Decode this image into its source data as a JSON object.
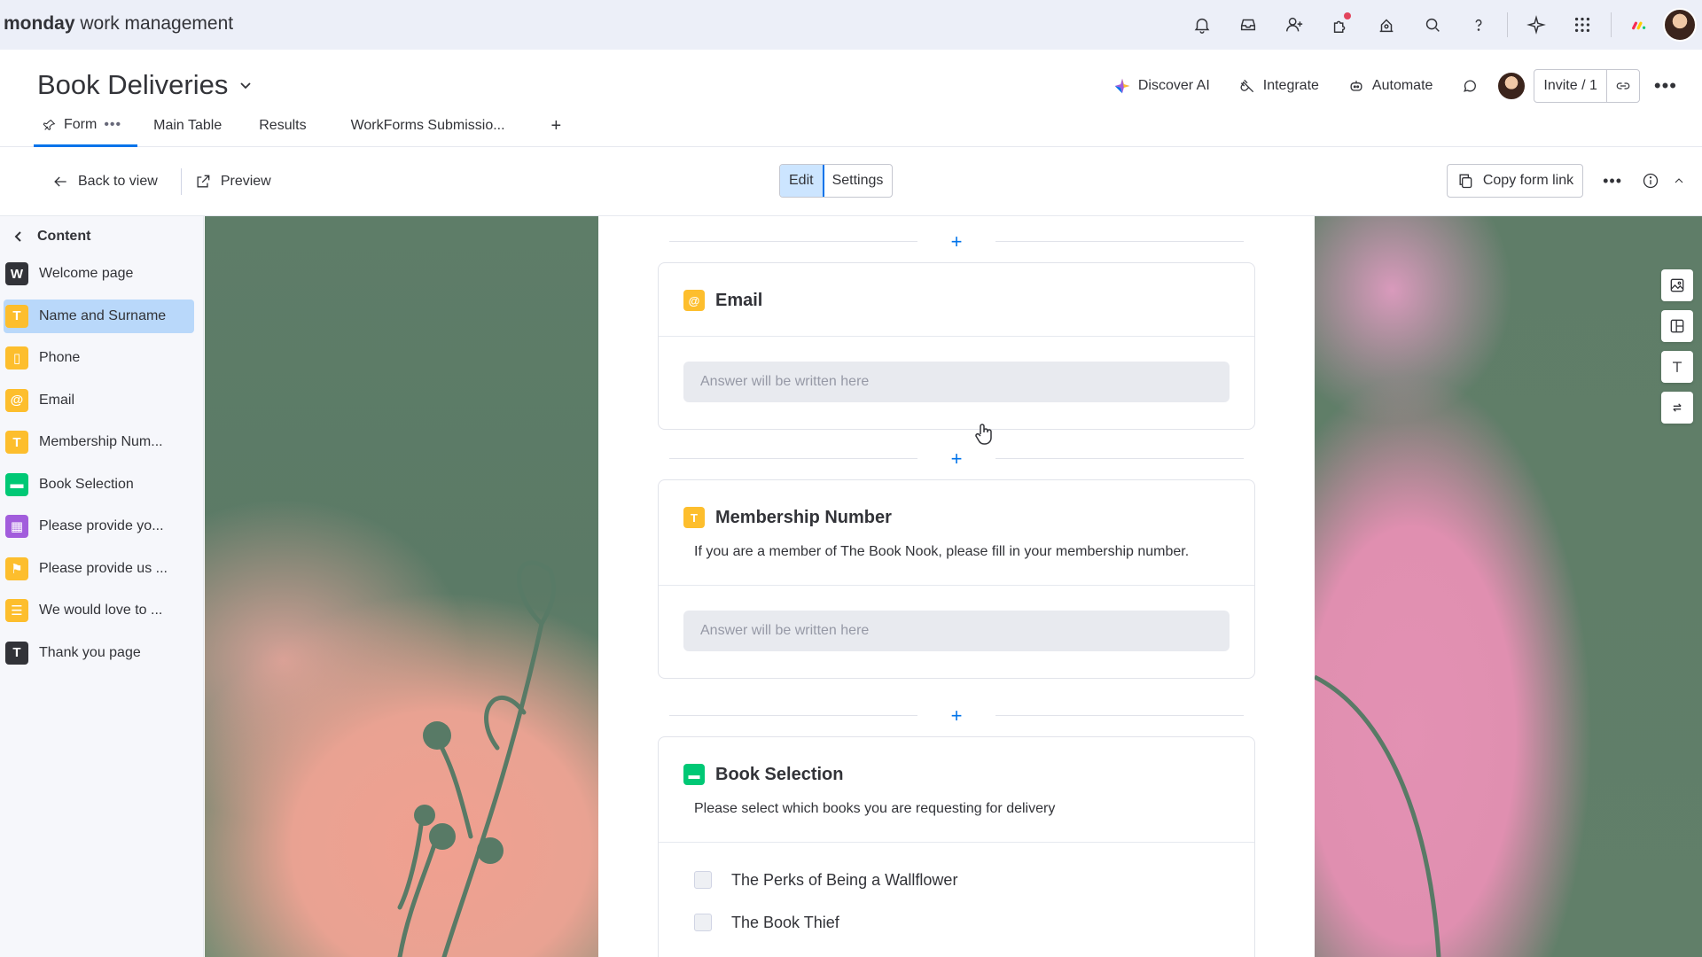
{
  "brand": {
    "bold": "monday",
    "rest": " work management"
  },
  "top_icons": [
    "bell-icon",
    "inbox-icon",
    "invite-user-icon",
    "apps-icon",
    "marketplace-icon",
    "search-icon",
    "help-icon",
    "ai-sparkle-icon",
    "grid-menu-icon"
  ],
  "board": {
    "title": "Book Deliveries",
    "actions": {
      "discover_ai": "Discover AI",
      "integrate": "Integrate",
      "automate": "Automate"
    },
    "invite": "Invite / 1"
  },
  "tabs": [
    {
      "label": "Form"
    },
    {
      "label": "Main Table"
    },
    {
      "label": "Results"
    },
    {
      "label": "WorkForms Submissio..."
    }
  ],
  "tab_add": "+",
  "toolbar": {
    "back": "Back to view",
    "preview": "Preview",
    "edit": "Edit",
    "settings": "Settings",
    "copy_link": "Copy form link"
  },
  "sidebar": {
    "title": "Content",
    "items": [
      {
        "icon": "W",
        "label": "Welcome page"
      },
      {
        "icon": "T",
        "label": "Name and Surname"
      },
      {
        "icon": "▯",
        "label": "Phone"
      },
      {
        "icon": "@",
        "label": "Email"
      },
      {
        "icon": "T",
        "label": "Membership Num..."
      },
      {
        "icon": "▬",
        "label": "Book Selection"
      },
      {
        "icon": "▦",
        "label": "Please provide yo..."
      },
      {
        "icon": "⚑",
        "label": "Please provide us ..."
      },
      {
        "icon": "☰",
        "label": "We would love to ..."
      },
      {
        "icon": "T",
        "label": "Thank you page"
      }
    ]
  },
  "form": {
    "add_symbol": "+",
    "email": {
      "icon": "@",
      "title": "Email",
      "placeholder": "Answer will be written here"
    },
    "membership": {
      "icon": "T",
      "title": "Membership Number",
      "description": "If you are a member of The Book Nook, please fill in your membership number.",
      "placeholder": "Answer will be written here"
    },
    "book_selection": {
      "icon": "▬",
      "title": "Book Selection",
      "description": "Please select which books you are requesting for delivery",
      "options": [
        "The Perks of Being a Wallflower",
        "The Book Thief"
      ]
    }
  },
  "colors": {
    "accent": "#0073ea",
    "yellow": "#fdbe2d",
    "green": "#00c875",
    "purple": "#a25ddc"
  }
}
